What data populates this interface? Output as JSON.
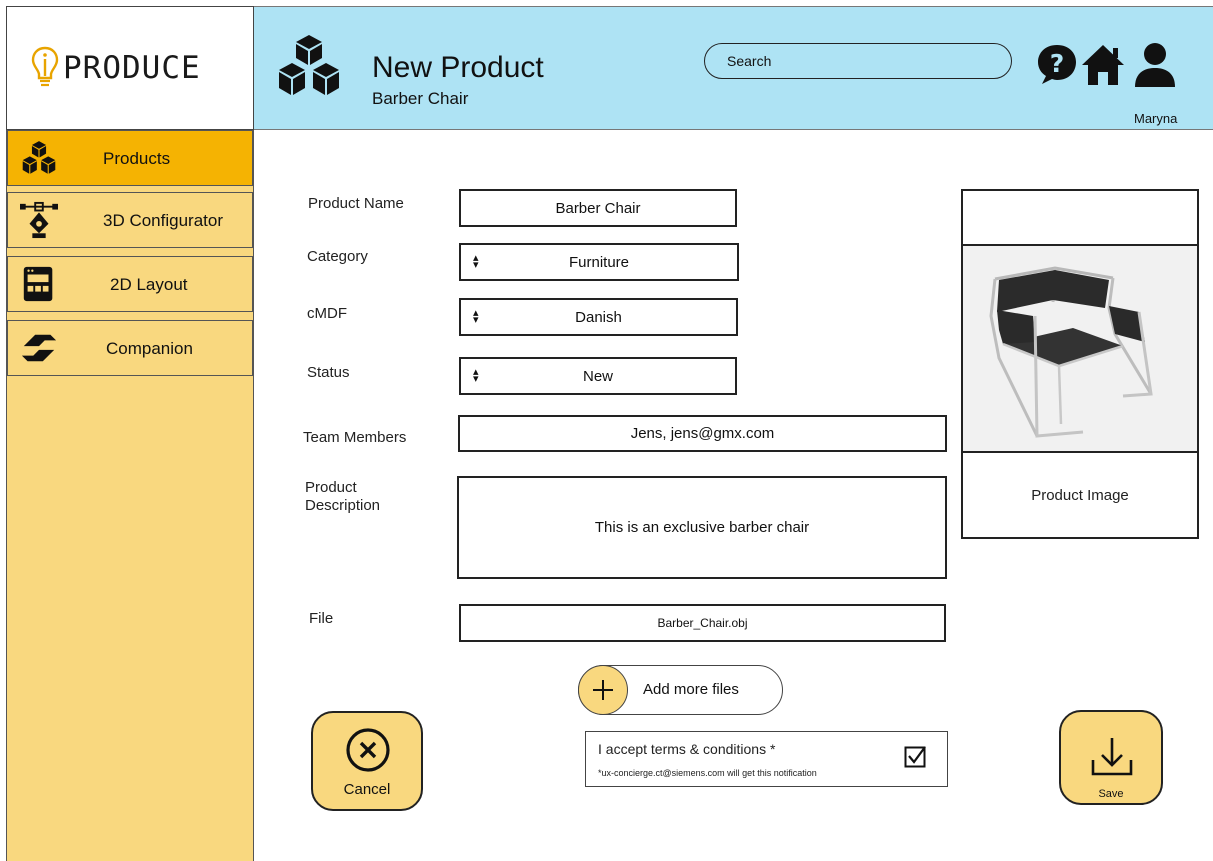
{
  "logo": {
    "text": "PRODUCE"
  },
  "header": {
    "title": "New Product",
    "subtitle": "Barber Chair",
    "search_placeholder": "Search",
    "username": "Maryna",
    "background": "#aee3f4"
  },
  "sidebar": {
    "background": "#f9d87f",
    "active_color": "#f5b302",
    "items": [
      {
        "label": "Products",
        "icon": "cubes-icon",
        "active": true
      },
      {
        "label": "3D Configurator",
        "icon": "pen-tool-icon",
        "active": false
      },
      {
        "label": "2D Layout",
        "icon": "layout-icon",
        "active": false
      },
      {
        "label": "Companion",
        "icon": "handshake-icon",
        "active": false
      }
    ]
  },
  "form": {
    "product_name": {
      "label": "Product Name",
      "value": "Barber Chair"
    },
    "category": {
      "label": "Category",
      "value": "Furniture"
    },
    "cmdf": {
      "label": "cMDF",
      "value": "Danish"
    },
    "status": {
      "label": "Status",
      "value": "New"
    },
    "team_members": {
      "label": "Team Members",
      "value": "Jens, jens@gmx.com"
    },
    "description": {
      "label_line1": "Product",
      "label_line2": "Description",
      "value": "This is an exclusive barber chair"
    },
    "file": {
      "label": "File",
      "value": "Barber_Chair.obj"
    },
    "add_files": "Add more files"
  },
  "image_panel": {
    "caption": "Product Image"
  },
  "terms": {
    "text": "I accept terms & conditions *",
    "note": "*ux-concierge.ct@siemens.com will get this notification",
    "checked": true
  },
  "actions": {
    "cancel": "Cancel",
    "save": "Save"
  }
}
